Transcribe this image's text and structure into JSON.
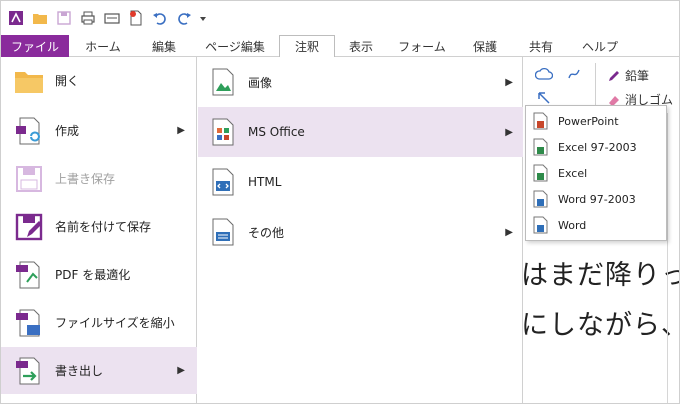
{
  "qat": {
    "icons": [
      "app-logo-icon",
      "open-folder-icon",
      "save-icon",
      "print-icon",
      "scan-icon",
      "new-document-icon",
      "undo-icon",
      "redo-icon",
      "customize-dropdown-icon"
    ]
  },
  "tabs": [
    {
      "label": "ファイル",
      "state": "file"
    },
    {
      "label": "ホーム",
      "state": ""
    },
    {
      "label": "編集",
      "state": ""
    },
    {
      "label": "ページ編集",
      "state": ""
    },
    {
      "label": "注釈",
      "state": "active"
    },
    {
      "label": "表示",
      "state": ""
    },
    {
      "label": "フォーム",
      "state": ""
    },
    {
      "label": "保護",
      "state": ""
    },
    {
      "label": "共有",
      "state": ""
    },
    {
      "label": "ヘルプ",
      "state": ""
    }
  ],
  "ribbon": {
    "pencil_label": "鉛筆",
    "eraser_label": "消しゴム"
  },
  "document": {
    "line1": "はまだ降りっ",
    "line2": "にしながら、"
  },
  "left_menu": {
    "items": [
      {
        "label": "開く",
        "state": ""
      },
      {
        "label": "作成",
        "state": "",
        "arrow": "▶"
      },
      {
        "label": "上書き保存",
        "state": "disabled"
      },
      {
        "label": "名前を付けて保存",
        "state": ""
      },
      {
        "label": "PDF を最適化",
        "state": ""
      },
      {
        "label": "ファイルサイズを縮小",
        "state": ""
      },
      {
        "label": "書き出し",
        "state": "selected",
        "arrow": "▶"
      }
    ]
  },
  "export_menu": {
    "items": [
      {
        "label": "画像",
        "state": "",
        "arrow": "▶"
      },
      {
        "label": "MS Office",
        "state": "selected",
        "arrow": "▶"
      },
      {
        "label": "HTML",
        "state": ""
      },
      {
        "label": "その他",
        "state": "",
        "arrow": "▶"
      }
    ]
  },
  "office_menu": {
    "items": [
      {
        "label": "PowerPoint",
        "color": "#c8472b"
      },
      {
        "label": "Excel 97-2003",
        "color": "#2e8b4a"
      },
      {
        "label": "Excel",
        "color": "#2e8b4a"
      },
      {
        "label": "Word 97-2003",
        "color": "#2f6fb8"
      },
      {
        "label": "Word",
        "color": "#2f6fb8"
      }
    ]
  },
  "colors": {
    "brand": "#8a2b9c",
    "selected_bg": "#ece2f0"
  }
}
